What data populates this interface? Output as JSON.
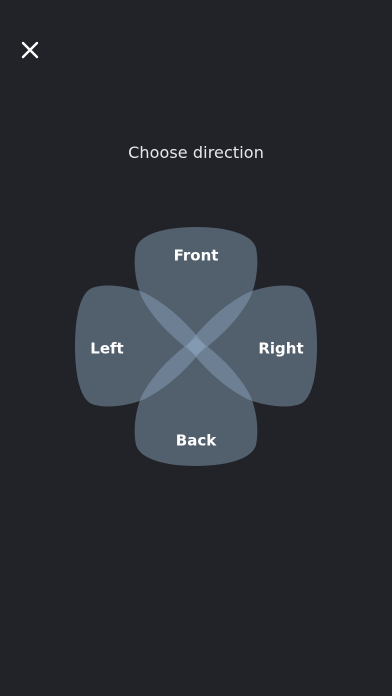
{
  "header": {
    "close_icon": "close-icon"
  },
  "main": {
    "title": "Choose direction"
  },
  "direction_pad": {
    "front_label": "Front",
    "left_label": "Left",
    "right_label": "Right",
    "back_label": "Back",
    "petal_color": "#8ea6bf",
    "background_color": "#212328"
  }
}
